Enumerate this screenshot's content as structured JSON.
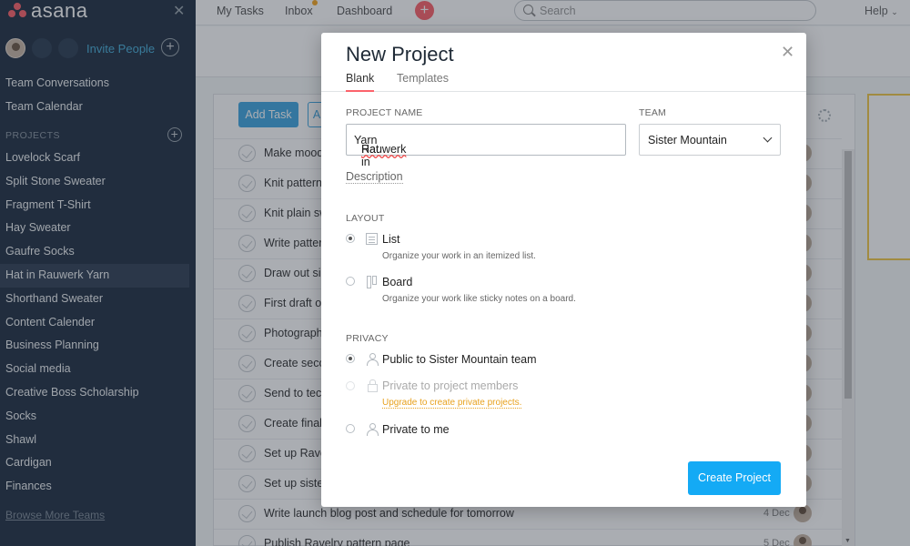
{
  "app": {
    "logo_text": "asana",
    "brand_color": "#fc636b",
    "accent_color": "#14aaf5"
  },
  "sidebar": {
    "invite_label": "Invite People",
    "nav": [
      "Team Conversations",
      "Team Calendar"
    ],
    "projects_header": "PROJECTS",
    "projects": [
      "Lovelock Scarf",
      "Split Stone Sweater",
      "Fragment T-Shirt",
      "Hay Sweater",
      "Gaufre Socks",
      "Hat in Rauwerk Yarn",
      "Shorthand Sweater",
      "Content Calender",
      "Business Planning",
      "Social media",
      "Creative Boss Scholarship",
      "Socks",
      "Shawl",
      "Cardigan",
      "Finances"
    ],
    "active_project": "Hat in Rauwerk Yarn",
    "browse_teams": "Browse More Teams"
  },
  "topbar": {
    "my_tasks": "My Tasks",
    "inbox": "Inbox",
    "dashboard": "Dashboard",
    "search_placeholder": "Search",
    "help": "Help"
  },
  "tasks_panel": {
    "add_task_label": "Add Task",
    "second_button_label": "A",
    "tasks": [
      {
        "name": "Make mood",
        "date": ""
      },
      {
        "name": "Knit pattern",
        "date": ""
      },
      {
        "name": "Knit plain sw",
        "date": ""
      },
      {
        "name": "Write patter",
        "date": ""
      },
      {
        "name": "Draw out siz",
        "date": ""
      },
      {
        "name": "First draft of",
        "date": ""
      },
      {
        "name": "Photograph",
        "date": ""
      },
      {
        "name": "Create secon",
        "date": ""
      },
      {
        "name": "Send to tech",
        "date": ""
      },
      {
        "name": "Create final",
        "date": ""
      },
      {
        "name": "Set up Rave",
        "date": ""
      },
      {
        "name": "Set up sister",
        "date": ""
      },
      {
        "name": "Write launch blog post and schedule for tomorrow",
        "date": "4 Dec"
      },
      {
        "name": "Publish Ravelry pattern page",
        "date": "5 Dec"
      }
    ]
  },
  "modal": {
    "title": "New Project",
    "tabs": [
      "Blank",
      "Templates"
    ],
    "active_tab": "Blank",
    "project_name_label": "PROJECT NAME",
    "project_name_prefix": "Hat in ",
    "project_name_misspelled": "Rauwerk",
    "project_name_suffix": " Yarn",
    "team_label": "TEAM",
    "team_value": "Sister Mountain",
    "description_link": "Description",
    "layout_label": "LAYOUT",
    "layout_options": [
      {
        "label": "List",
        "description": "Organize your work in an itemized list.",
        "checked": true
      },
      {
        "label": "Board",
        "description": "Organize your work like sticky notes on a board.",
        "checked": false
      }
    ],
    "privacy_label": "PRIVACY",
    "privacy_options": [
      {
        "label": "Public to Sister Mountain team",
        "checked": true,
        "disabled": false
      },
      {
        "label": "Private to project members",
        "checked": false,
        "disabled": true
      },
      {
        "label": "Private to me",
        "checked": false,
        "disabled": false
      }
    ],
    "upgrade_link": "Upgrade to create private projects.",
    "create_button": "Create Project"
  }
}
